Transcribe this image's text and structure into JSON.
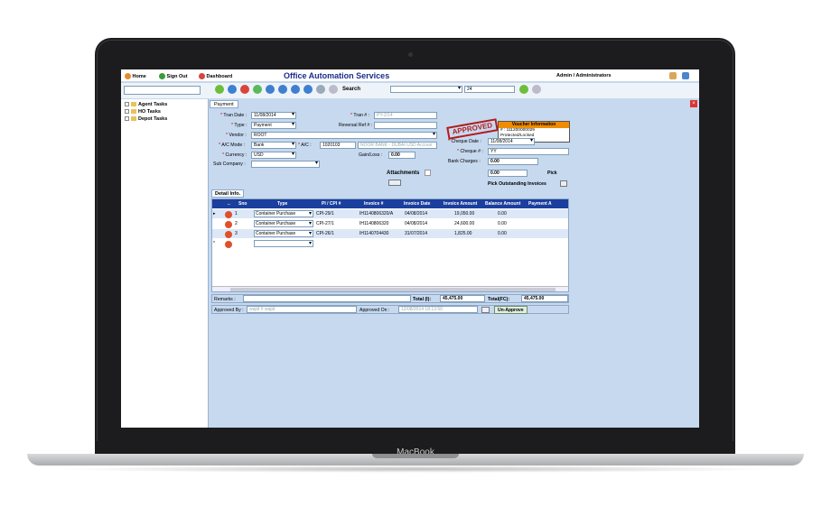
{
  "device": {
    "brand": "MacBook"
  },
  "topbar": {
    "home": "Home",
    "signout": "Sign Out",
    "dashboard": "Dashboard",
    "title": "Office Automation Services",
    "user": "Admin / Administrators"
  },
  "toolbar": {
    "search_label": "Search",
    "search_value": "",
    "page_select": "24"
  },
  "sidebar": {
    "items": [
      {
        "label": "Agent Tasks"
      },
      {
        "label": "HO Tasks"
      },
      {
        "label": "Depot Tasks"
      }
    ]
  },
  "tab": {
    "label": "Payment"
  },
  "form": {
    "tran_date_label": "Tran Date :",
    "tran_date": "11/08/2014",
    "type_label": "Type :",
    "type": "Payment",
    "vendor_label": "Vendor :",
    "vendor": "ROOT",
    "ac_mode_label": "A/C Mode :",
    "ac_mode": "Bank",
    "ac_label": "A/C :",
    "ac": "1020103",
    "ac_name": "NOOR BANK - DUBAI USD Accoun",
    "currency_label": "Currency :",
    "currency": "USD",
    "gain_loss_label": "Gain/Loss :",
    "gain_loss": "0.00",
    "sub_company_label": "Sub Company :",
    "sub_company": "",
    "tran_no_label": "Tran # :",
    "tran_no": "PY-2/14",
    "reversal_label": "Reversal Ref # :",
    "reversal": "",
    "attachments_label": "Attachments",
    "stamp": "APPROVED",
    "cheque_date_label": "Cheque Date :",
    "cheque_date": "11/08/2014",
    "cheque_no_label": "Cheque # :",
    "cheque_no": "YY",
    "bank_charges_label": "Bank Charges :",
    "bank_charges": "0.00",
    "pick_value": "0.00",
    "pick_label": "Pick",
    "pick_outstanding": "Pick Outstanding Invoices"
  },
  "voucher": {
    "header": "Voucher Information",
    "number": "# : 111200000029",
    "status": "Protected/Locked"
  },
  "detail": {
    "tab": "Detail Info.",
    "columns": [
      "..",
      "Sno",
      "Type",
      "PI / CPI #",
      "Invoice #",
      "Invoice Date",
      "Invoice Amount",
      "Balance Amount",
      "Payment A"
    ],
    "rows": [
      {
        "sno": "1",
        "type": "Container Purchase",
        "pi": "CPI-29/1",
        "inv": "IH1140806320/A",
        "date": "04/08/2014",
        "amt": "19,050.00",
        "bal": "0.00"
      },
      {
        "sno": "2",
        "type": "Container Purchase",
        "pi": "CPI-27/1",
        "inv": "IH1140806320",
        "date": "04/08/2014",
        "amt": "24,600.00",
        "bal": "0.00"
      },
      {
        "sno": "3",
        "type": "Container Purchase",
        "pi": "CPI-26/1",
        "inv": "IH1140704430",
        "date": "31/07/2014",
        "amt": "1,825.00",
        "bal": "0.00"
      }
    ]
  },
  "totals": {
    "remarks_label": "Remarks :",
    "total_label": "Total (I):",
    "total": "45,475.00",
    "total_fc_label": "Total(FC):",
    "total_fc": "45,475.00"
  },
  "approval": {
    "approved_by_label": "Approved By :",
    "approved_by": "wajid # wajid",
    "approved_on_label": "Approved On :",
    "approved_on": "12/08/2014 18:13:50",
    "unapprove": "Un-Approve"
  }
}
